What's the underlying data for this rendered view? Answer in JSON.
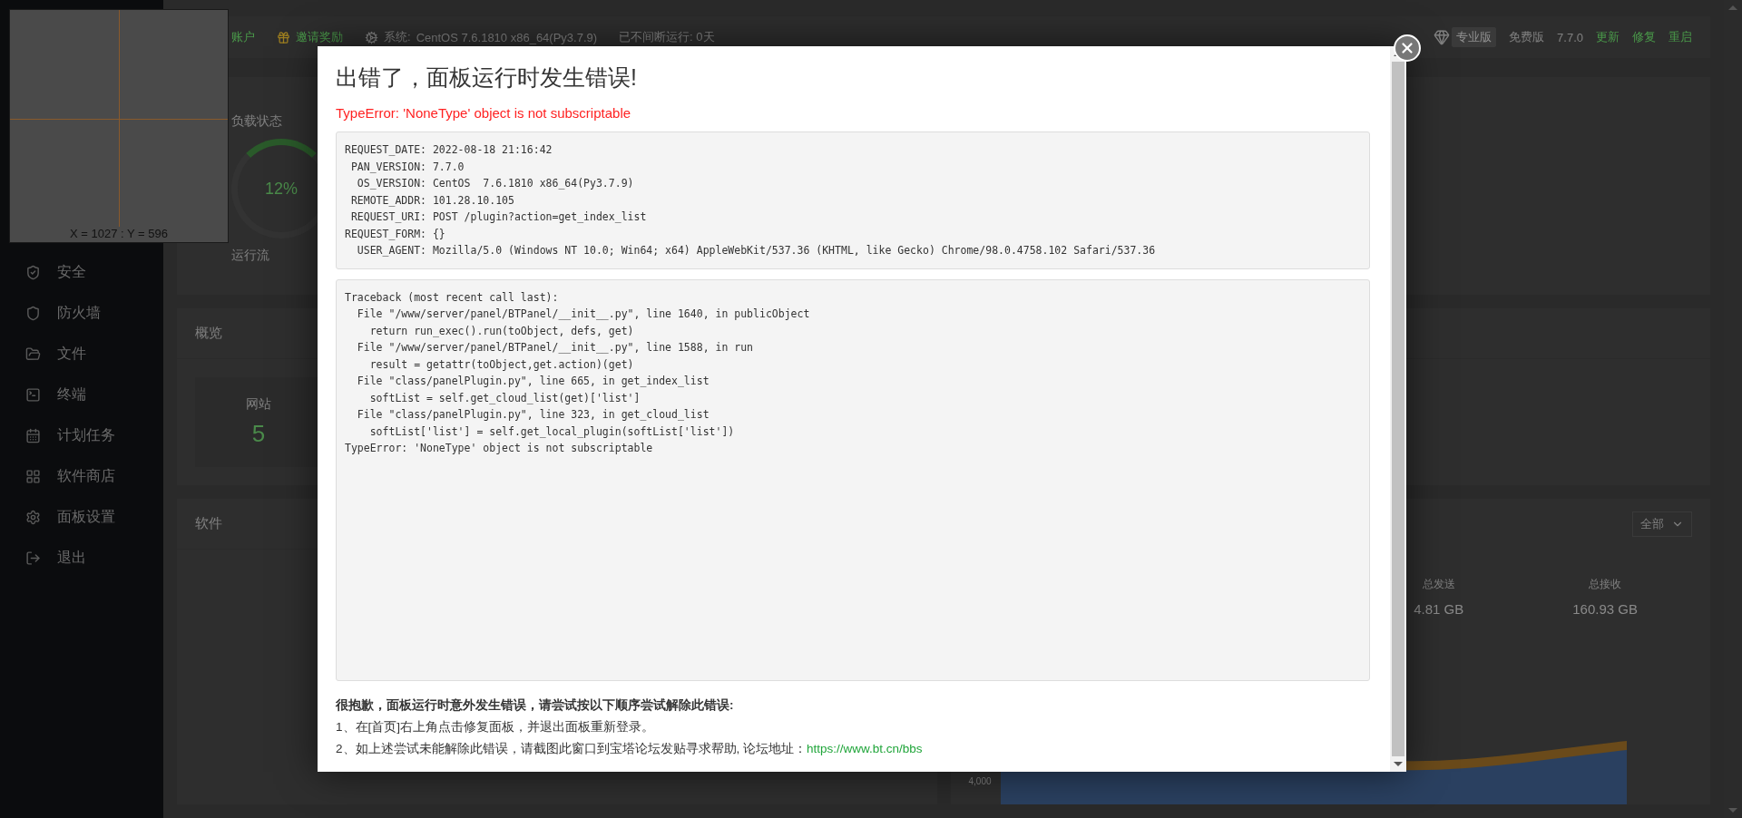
{
  "magnifier": {
    "coordinates": "X = 1027 : Y = 596"
  },
  "header": {
    "account": "账户",
    "invite": "邀请奖励",
    "system_label": "系统:",
    "system_value": "CentOS 7.6.1810 x86_64(Py3.7.9)",
    "uptime": "已不间断运行: 0天",
    "pro_badge": "专业版",
    "edition": "免费版",
    "version": "7.7.0",
    "links": [
      "更新",
      "修复",
      "重启"
    ]
  },
  "sidebar": {
    "items": [
      {
        "label": "安全"
      },
      {
        "label": "防火墙"
      },
      {
        "label": "文件"
      },
      {
        "label": "终端"
      },
      {
        "label": "计划任务"
      },
      {
        "label": "软件商店"
      },
      {
        "label": "面板设置"
      },
      {
        "label": "退出"
      }
    ]
  },
  "load_card": {
    "title": "负载状态",
    "percent": "12%",
    "status": "运行流"
  },
  "overview_card": {
    "title": "概览",
    "site_label": "网站",
    "site_count": "5"
  },
  "software_card": {
    "title": "软件"
  },
  "traffic_card": {
    "filter": "全部",
    "stats": [
      {
        "label": "总发送",
        "value": "4.81 GB"
      },
      {
        "label": "总接收",
        "value": "160.93 GB"
      }
    ],
    "axis_tick": "4,000"
  },
  "modal": {
    "title": "出错了，面板运行时发生错误!",
    "error": "TypeError: 'NoneType' object is not subscriptable",
    "request_info": "REQUEST_DATE: 2022-08-18 21:16:42\n PAN_VERSION: 7.7.0\n  OS_VERSION: CentOS  7.6.1810 x86_64(Py3.7.9)\n REMOTE_ADDR: 101.28.10.105\n REQUEST_URI: POST /plugin?action=get_index_list\nREQUEST_FORM: {}\n  USER_AGENT: Mozilla/5.0 (Windows NT 10.0; Win64; x64) AppleWebKit/537.36 (KHTML, like Gecko) Chrome/98.0.4758.102 Safari/537.36",
    "traceback": "Traceback (most recent call last):\n  File \"/www/server/panel/BTPanel/__init__.py\", line 1640, in publicObject\n    return run_exec().run(toObject, defs, get)\n  File \"/www/server/panel/BTPanel/__init__.py\", line 1588, in run\n    result = getattr(toObject,get.action)(get)\n  File \"class/panelPlugin.py\", line 665, in get_index_list\n    softList = self.get_cloud_list(get)['list']\n  File \"class/panelPlugin.py\", line 323, in get_cloud_list\n    softList['list'] = self.get_local_plugin(softList['list'])\nTypeError: 'NoneType' object is not subscriptable",
    "help_title": "很抱歉，面板运行时意外发生错误，请尝试按以下顺序尝试解除此错误:",
    "steps": [
      {
        "text": "1、在[首页]右上角点击修复面板，并退出面板重新登录。"
      },
      {
        "text": "2、如上述尝试未能解除此错误，请截图此窗口到宝塔论坛发贴寻求帮助, 论坛地址：",
        "link": "https://www.bt.cn/bbs"
      }
    ]
  }
}
